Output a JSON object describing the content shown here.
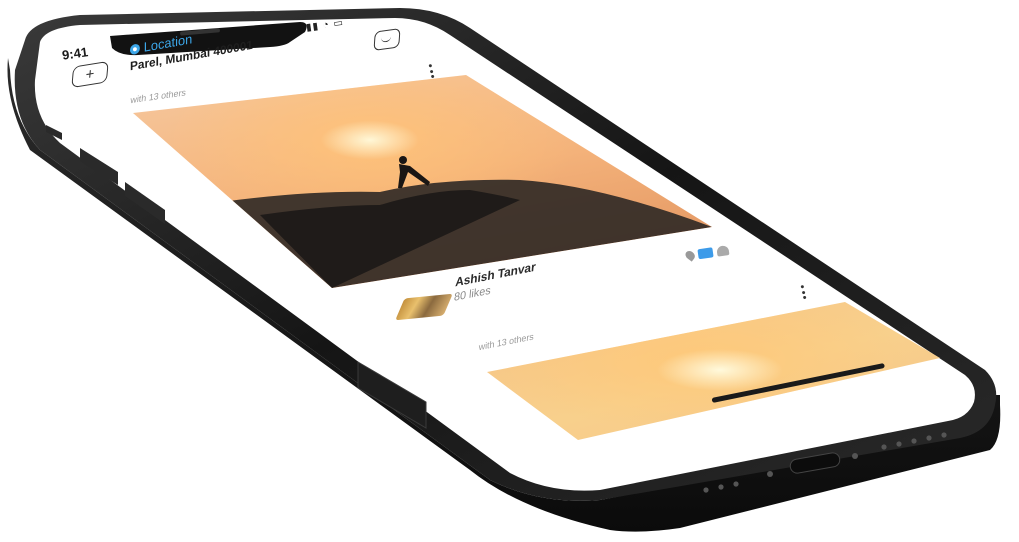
{
  "status_bar": {
    "time": "9:41"
  },
  "header": {
    "location_label": "Location",
    "location_value": "Parel, Mumbai 400001"
  },
  "posts": [
    {
      "with_text": "with 13 others",
      "author": "Ashish Tanvar",
      "likes": "80 likes"
    },
    {
      "with_text": "with 13 others"
    }
  ],
  "icons": [
    "add-icon",
    "location-pin-icon",
    "chat-icon",
    "more-vertical-icon",
    "pin-icon",
    "comment-icon",
    "heart-icon"
  ],
  "colors": {
    "accent": "#3ca6e8",
    "phone_frame": "#1c1c1c",
    "screen_bg": "#ffffff"
  }
}
